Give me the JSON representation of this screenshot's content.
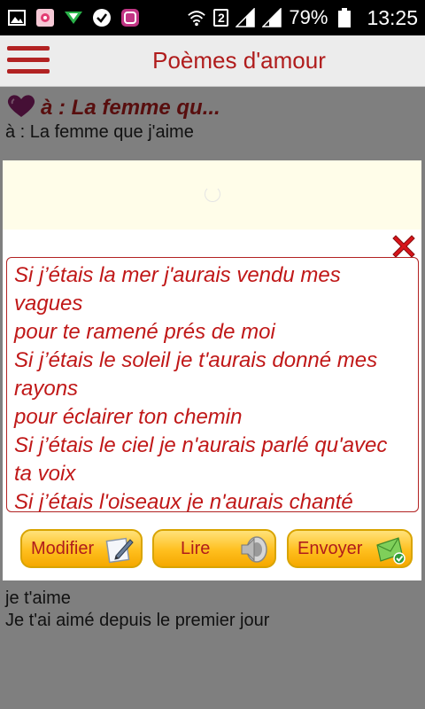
{
  "status_bar": {
    "sim_badge": "2",
    "battery_percent": "79%",
    "time": "13:25"
  },
  "app_bar": {
    "title": "Poèmes d'amour"
  },
  "poem_header": {
    "title": "à : La femme qu...",
    "subtitle": "à : La femme que j'aime"
  },
  "poem_body_visible": [
    "je t'aime",
    "Je t'ai aimé depuis le premier jour"
  ],
  "dialog": {
    "poem_lines": [
      "Si j’étais la mer j'aurais vendu mes",
      "vagues",
      "pour te ramené prés de moi",
      "Si j’étais le soleil je t'aurais donné mes",
      "rayons",
      "pour éclairer ton chemin",
      "Si j’étais le ciel je n'aurais parlé qu'avec",
      "ta voix",
      "Si j’étais l'oiseaux je n'aurais chanté"
    ],
    "buttons": {
      "modifier": "Modifier",
      "lire": "Lire",
      "envoyer": "Envoyer"
    }
  },
  "colors": {
    "accent_red": "#b01c1c",
    "button_gold": "#ffc21e"
  }
}
